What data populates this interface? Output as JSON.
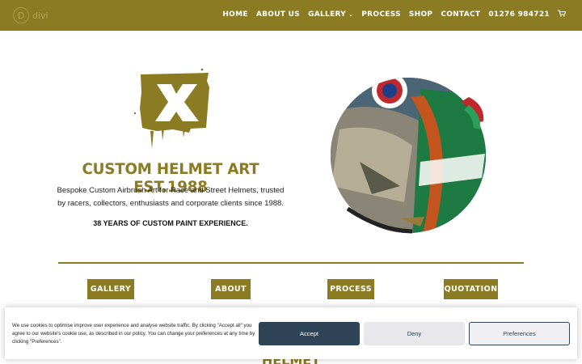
{
  "header": {
    "logo_letter": "D",
    "logo_text": "divi",
    "nav": [
      {
        "label": "HOME"
      },
      {
        "label": "ABOUT US"
      },
      {
        "label": "GALLERY",
        "has_dropdown": true
      },
      {
        "label": "PROCESS"
      },
      {
        "label": "SHOP"
      },
      {
        "label": "CONTACT"
      },
      {
        "label": "01276 984721"
      }
    ],
    "cart_icon": "cart-icon"
  },
  "hero": {
    "title": "CUSTOM HELMET ART EST.1988",
    "description": "Bespoke Custom Airbrush Art for Race and Street Helmets, trusted by racers, collectors, enthusiasts and corporate clients since 1988.",
    "years": "38 YEARS OF CUSTOM PAINT EXPERIENCE."
  },
  "buttons": [
    {
      "label": "GALLERY"
    },
    {
      "label": "ABOUT"
    },
    {
      "label": "PROCESS"
    },
    {
      "label": "QUOTATION"
    }
  ],
  "below_fold_heading": "HELMET PAINT",
  "cookie": {
    "text": "We use cookies to optimise improve user experience and analyse website traffic. By clicking \"Accept all\" you agree to our website's cookie use, as described in our policy.  You can change your preferences at any time by clicking \"Preferences\".",
    "accept": "Accept",
    "deny": "Deny",
    "preferences": "Preferences"
  },
  "colors": {
    "brand": "#8b7b22",
    "cookie_primary": "#2f4557"
  }
}
